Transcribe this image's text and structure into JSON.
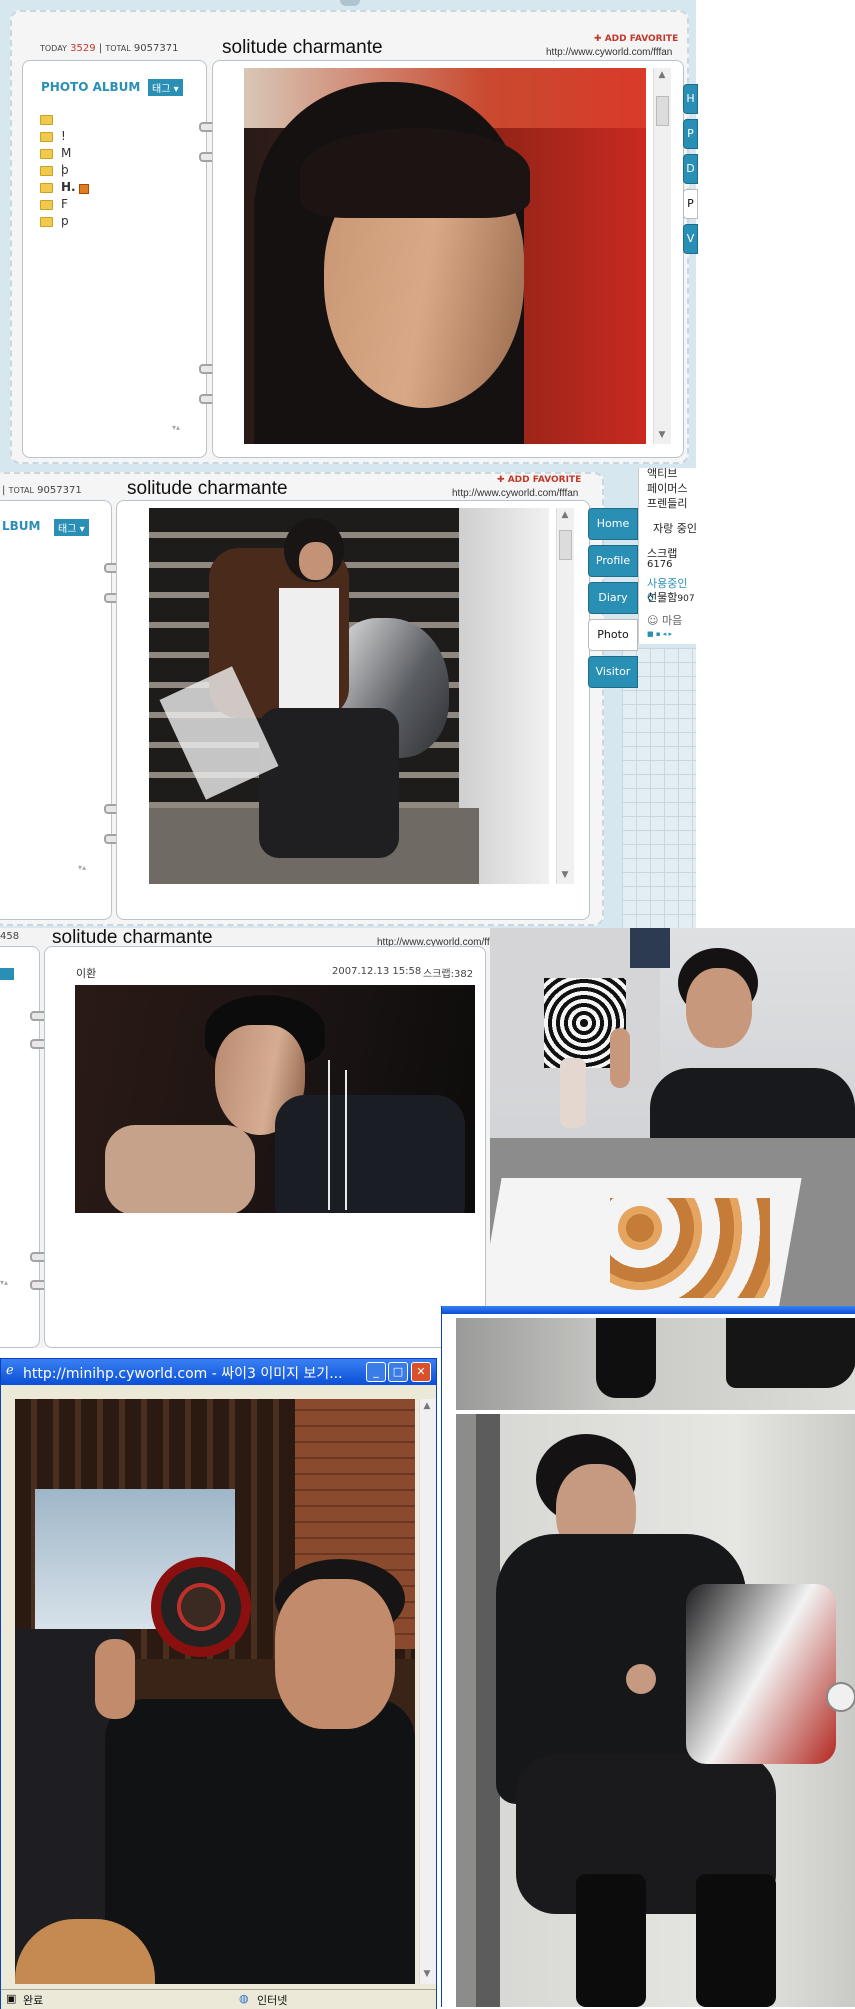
{
  "screenshot1": {
    "today_label": "TODAY",
    "today_count": "3529",
    "total_label": "TOTAL",
    "total_count": "9057371",
    "title": "solitude charmante",
    "add_favorite": "ADD FAVORITE",
    "url": "http://www.cyworld.com/fffan",
    "album_title": "PHOTO ALBUM",
    "tag_button": "태그",
    "folders": [
      "",
      "!",
      "M",
      "þ",
      "H.",
      "F",
      "p"
    ],
    "tabs": [
      "H",
      "P",
      "D",
      "P",
      "V"
    ]
  },
  "screenshot2": {
    "total_label": "TOTAL",
    "total_count": "9057371",
    "title": "solitude charmante",
    "add_favorite": "ADD FAVORITE",
    "url": "http://www.cyworld.com/fffan",
    "album_title": "LBUM",
    "tag_button": "태그",
    "tabs": [
      "Home",
      "Profile",
      "Diary",
      "Photo",
      "Visitor"
    ],
    "side_items": [
      "액티브",
      "페이머스",
      "프렌들리",
      "자랑 중인",
      "스크랩",
      "6176",
      "사용중인 0",
      "선물함",
      "907",
      "마음"
    ]
  },
  "screenshot3": {
    "side_count": "458",
    "title": "solitude charmante",
    "url": "http://www.cyworld.com/fffan",
    "author": "이환",
    "date": "2007.12.13 15:58",
    "scrap_label": "스크랩",
    "scrap_count": "382"
  },
  "popup": {
    "window_title": "http://minihp.cyworld.com - 싸이3 이미지 보기...",
    "status_left": "완료",
    "status_right": "인터넷"
  },
  "colors": {
    "accent_blue": "#2a8fb5",
    "skin_border": "#c9d7e0",
    "today_red": "#c0392b"
  }
}
